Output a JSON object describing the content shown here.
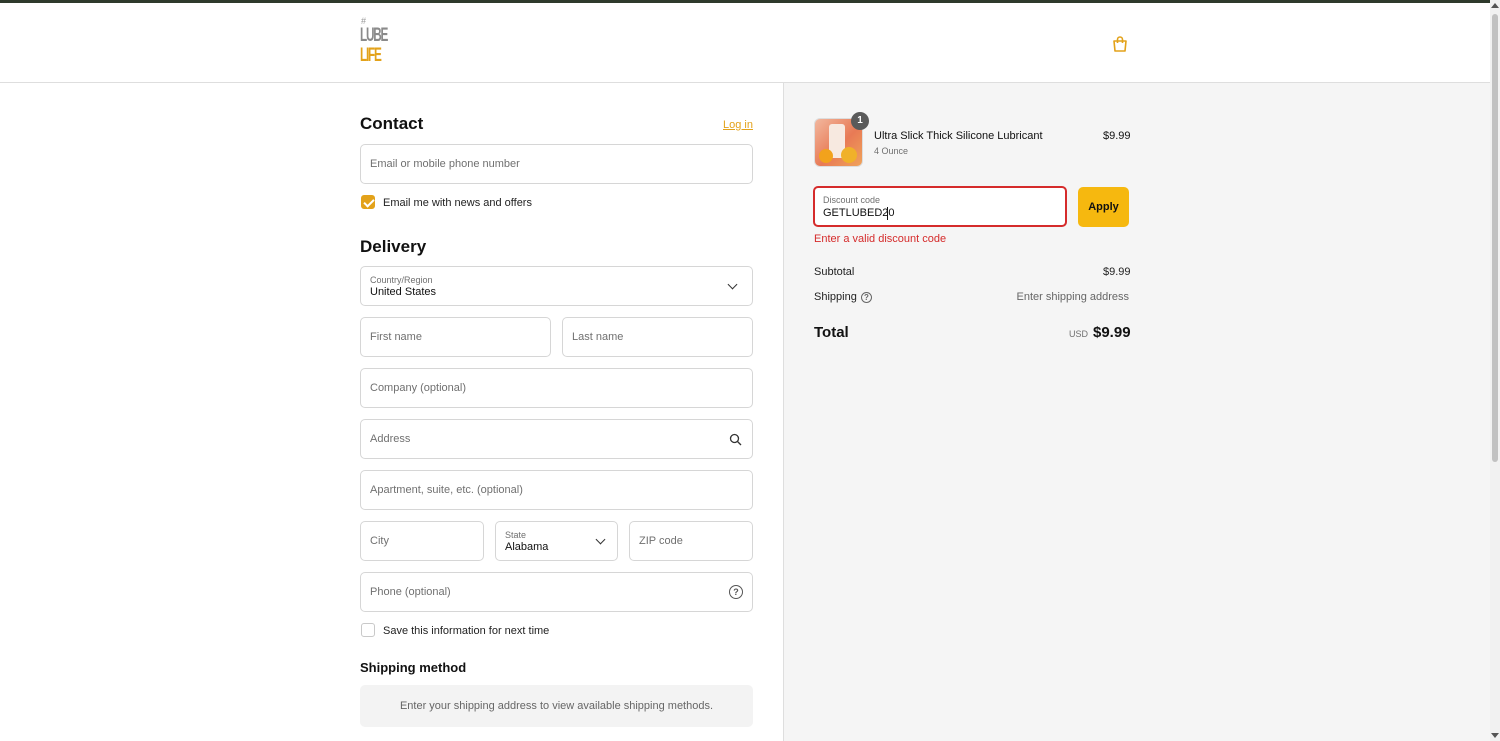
{
  "brand": {
    "logo_hash": "#",
    "logo_line1": "LUBE",
    "logo_line2": "LIFE"
  },
  "contact": {
    "heading": "Contact",
    "login_link": "Log in",
    "email_placeholder": "Email or mobile phone number",
    "news_checkbox_label": "Email me with news and offers",
    "news_checked": true
  },
  "delivery": {
    "heading": "Delivery",
    "country_label": "Country/Region",
    "country_value": "United States",
    "first_name_placeholder": "First name",
    "last_name_placeholder": "Last name",
    "company_placeholder": "Company (optional)",
    "address_placeholder": "Address",
    "apartment_placeholder": "Apartment, suite, etc. (optional)",
    "city_placeholder": "City",
    "state_label": "State",
    "state_value": "Alabama",
    "zip_placeholder": "ZIP code",
    "phone_placeholder": "Phone (optional)",
    "save_info_label": "Save this information for next time",
    "save_info_checked": false
  },
  "shipping_method": {
    "heading": "Shipping method",
    "notice": "Enter your shipping address to view available shipping methods."
  },
  "order_summary": {
    "item": {
      "name": "Ultra Slick Thick Silicone Lubricant",
      "variant": "4 Ounce",
      "price": "$9.99",
      "quantity": "1"
    },
    "discount": {
      "label": "Discount code",
      "value": "GETLUBED20",
      "apply_label": "Apply",
      "error": "Enter a valid discount code"
    },
    "subtotal_label": "Subtotal",
    "subtotal_value": "$9.99",
    "shipping_label": "Shipping",
    "shipping_value": "Enter shipping address",
    "total_label": "Total",
    "currency": "USD",
    "total_value": "$9.99"
  },
  "colors": {
    "accent": "#e3a21a",
    "apply_button": "#f6b80f",
    "error": "#d52b2b"
  },
  "icons": [
    "bag-icon",
    "chevron-down-icon",
    "search-icon",
    "help-circle-icon",
    "check-icon"
  ]
}
